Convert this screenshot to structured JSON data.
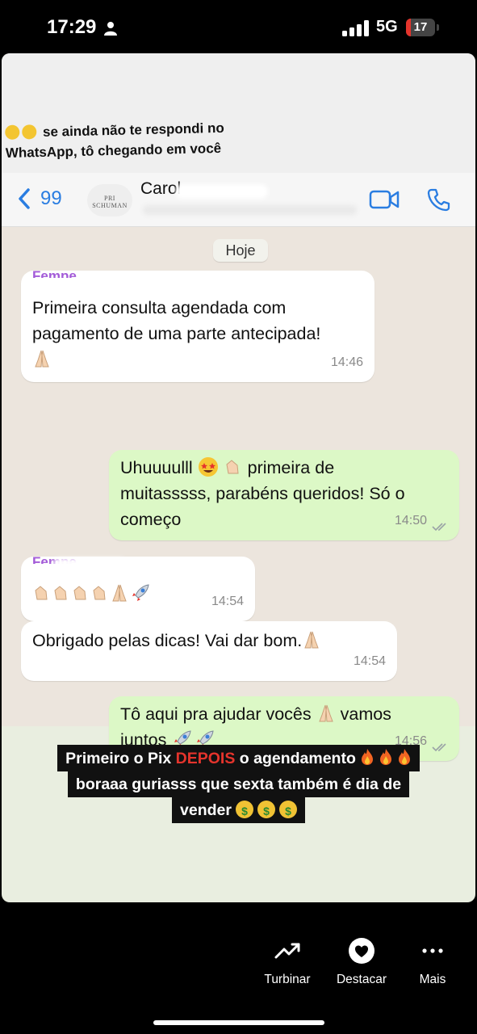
{
  "status_bar": {
    "time": "17:29",
    "network": "5G",
    "battery_level": "17",
    "battery_fraction": 0.17,
    "battery_color": "#e5342c"
  },
  "story": {
    "top_caption": {
      "line1": "se ainda não te respondi no",
      "line2": "WhatsApp, tô chegando em você"
    },
    "whatsapp_header": {
      "back_count": "99",
      "avatar_text": "PRI SCHUMAN",
      "contact_name_visible": "Carol",
      "accent_color": "#2a7de1"
    },
    "chat": {
      "day_label": "Hoje",
      "messages": [
        {
          "direction": "in",
          "sender_visible": "Fempe",
          "text_lines": [
            "Primeira consulta agendada com",
            "pagamento de uma parte antecipada!"
          ],
          "emoji": "🙏🏻",
          "time": "14:46"
        },
        {
          "direction": "out",
          "text_lines": [
            "Uhuuuulll",
            "primeira de",
            "muitasssss, parabéns queridos! Só o",
            "começo"
          ],
          "emoji": "🤩👏🏻",
          "time": "14:50"
        },
        {
          "direction": "in",
          "sender_visible": "Fempe",
          "emoji": "👏🏻👏🏻👏🏻👏🏻🙏🏻🚀",
          "time": "14:54"
        },
        {
          "direction": "in",
          "text_lines": [
            "Obrigado pelas dicas! Vai dar bom."
          ],
          "emoji": "🙏🏻",
          "time": "14:54"
        },
        {
          "direction": "out",
          "text_lines": [
            "Tô aqui pra ajudar vocês",
            "vamos",
            "juntos"
          ],
          "emoji": "🙏🏻🚀🚀",
          "time": "14:56"
        }
      ]
    },
    "bottom_caption": {
      "line1_a": "Primeiro o Pix ",
      "line1_highlight": "DEPOIS",
      "line1_b": " o agendamento",
      "line2": "boraaa guriasss que sexta também é dia de",
      "line3": "vender",
      "highlight_color": "#e5342c"
    }
  },
  "actions": [
    {
      "label": "Turbinar",
      "icon": "trending-up-icon"
    },
    {
      "label": "Destacar",
      "icon": "heart-circle-icon"
    },
    {
      "label": "Mais",
      "icon": "more-dots-icon"
    }
  ]
}
